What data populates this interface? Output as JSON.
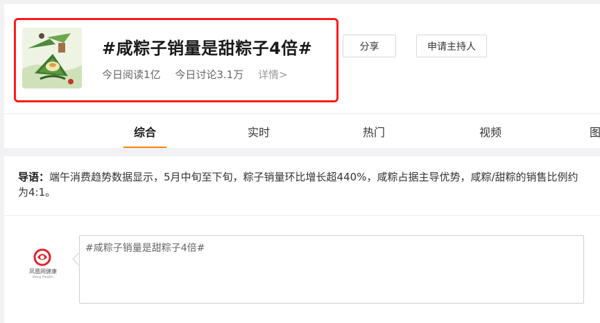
{
  "topic": {
    "title": "#咸粽子销量是甜粽子4倍#",
    "reads": "今日阅读1亿",
    "discussions": "今日讨论3.1万",
    "details_link": "详情>"
  },
  "actions": {
    "share_label": "分享",
    "host_label": "申请主持人"
  },
  "tabs": [
    {
      "label": "综合",
      "active": true
    },
    {
      "label": "实时",
      "active": false
    },
    {
      "label": "热门",
      "active": false
    },
    {
      "label": "视频",
      "active": false
    },
    {
      "label": "图",
      "active": false
    }
  ],
  "intro": {
    "label": "导语：",
    "text": "端午消费趋势数据显示，5月中旬至下旬，粽子销量环比增长超440%，咸粽占据主导优势，咸粽/甜粽的销售比例约为4:1。"
  },
  "compose": {
    "value": "#咸粽子销量是甜粽子4倍#"
  },
  "avatar": {
    "brand_text": "凤凰网健康",
    "brand_subtext": "ifeng Health"
  },
  "colors": {
    "highlight": "#ff1a1a",
    "tab_indicator": "#ff8200",
    "avatar_red": "#e3212a"
  }
}
